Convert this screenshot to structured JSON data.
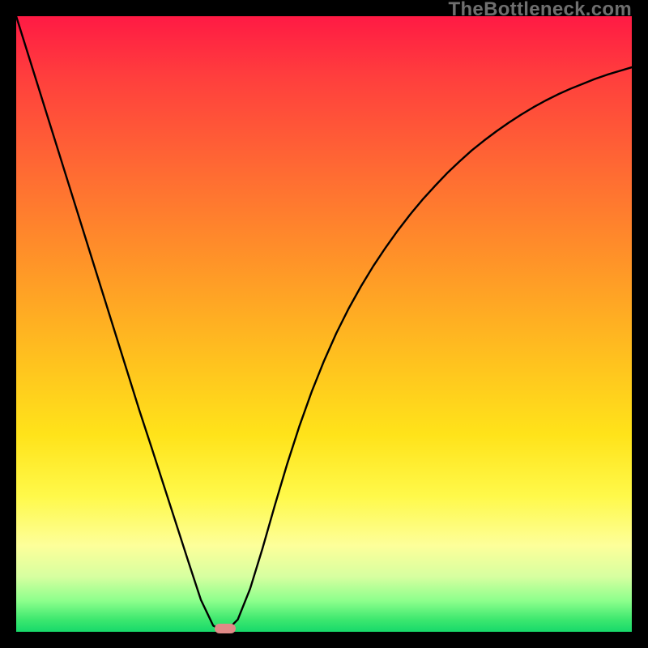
{
  "watermark": "TheBottleneck.com",
  "chart_data": {
    "type": "line",
    "title": "",
    "xlabel": "",
    "ylabel": "",
    "x": [
      0.0,
      0.02,
      0.04,
      0.06,
      0.08,
      0.1,
      0.12,
      0.14,
      0.16,
      0.18,
      0.2,
      0.22,
      0.24,
      0.26,
      0.28,
      0.3,
      0.32,
      0.34,
      0.36,
      0.38,
      0.4,
      0.42,
      0.44,
      0.46,
      0.48,
      0.5,
      0.52,
      0.54,
      0.56,
      0.58,
      0.6,
      0.62,
      0.64,
      0.66,
      0.68,
      0.7,
      0.72,
      0.74,
      0.76,
      0.78,
      0.8,
      0.82,
      0.84,
      0.86,
      0.88,
      0.9,
      0.92,
      0.94,
      0.96,
      0.98,
      1.0
    ],
    "values": [
      1.0,
      0.936,
      0.872,
      0.808,
      0.744,
      0.68,
      0.616,
      0.552,
      0.488,
      0.424,
      0.36,
      0.299,
      0.237,
      0.175,
      0.113,
      0.052,
      0.01,
      0.0,
      0.02,
      0.07,
      0.135,
      0.205,
      0.272,
      0.334,
      0.39,
      0.44,
      0.485,
      0.525,
      0.561,
      0.594,
      0.624,
      0.652,
      0.678,
      0.702,
      0.724,
      0.745,
      0.764,
      0.782,
      0.798,
      0.813,
      0.827,
      0.84,
      0.852,
      0.863,
      0.873,
      0.882,
      0.89,
      0.898,
      0.905,
      0.911,
      0.917
    ],
    "xlim": [
      0,
      1
    ],
    "ylim": [
      0,
      1
    ],
    "grid": false,
    "legend": false,
    "marker": {
      "x": 0.34,
      "y": 0.0,
      "color": "#e08a87"
    },
    "background_gradient": {
      "top": "#ff1a44",
      "bottom": "#17d96a"
    }
  }
}
